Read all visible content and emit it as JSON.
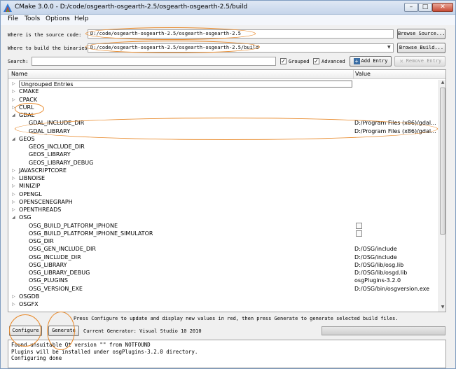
{
  "window": {
    "title": "CMake 3.0.0 - D:/code/osgearth-osgearth-2.5/osgearth-osgearth-2.5/build",
    "minimize": "–",
    "maximize": "□",
    "close": "✕"
  },
  "menu": [
    "File",
    "Tools",
    "Options",
    "Help"
  ],
  "source": {
    "label": "Where is the source code:",
    "value": "D:/code/osgearth-osgearth-2.5/osgearth-osgearth-2.5",
    "button": "Browse Source..."
  },
  "build": {
    "label": "Where to build the binaries:",
    "value": "D:/code/osgearth-osgearth-2.5/osgearth-osgearth-2.5/build",
    "dropdown": "▼",
    "button": "Browse Build..."
  },
  "search": {
    "label": "Search:",
    "value": "",
    "grouped_label": "Grouped",
    "grouped_checked": true,
    "advanced_label": "Advanced",
    "advanced_checked": true,
    "add_entry": "Add Entry",
    "remove_entry": "Remove Entry"
  },
  "table": {
    "col_name": "Name",
    "col_value": "Value",
    "rows": [
      {
        "name": "Ungrouped Entries",
        "level": 0,
        "arrow": "▷",
        "value": "",
        "edit": true
      },
      {
        "name": "CMAKE",
        "level": 0,
        "arrow": "▷",
        "value": ""
      },
      {
        "name": "CPACK",
        "level": 0,
        "arrow": "▷",
        "value": ""
      },
      {
        "name": "CURL",
        "level": 0,
        "arrow": "▷",
        "value": ""
      },
      {
        "name": "GDAL",
        "level": 0,
        "arrow": "◢",
        "value": ""
      },
      {
        "name": "GDAL_INCLUDE_DIR",
        "level": 1,
        "arrow": "",
        "value": "D:/Program Files (x86)/gdal..."
      },
      {
        "name": "GDAL_LIBRARY",
        "level": 1,
        "arrow": "",
        "value": "D:/Program Files (x86)/gdal..."
      },
      {
        "name": "GEOS",
        "level": 0,
        "arrow": "◢",
        "value": ""
      },
      {
        "name": "GEOS_INCLUDE_DIR",
        "level": 1,
        "arrow": "",
        "value": ""
      },
      {
        "name": "GEOS_LIBRARY",
        "level": 1,
        "arrow": "",
        "value": ""
      },
      {
        "name": "GEOS_LIBRARY_DEBUG",
        "level": 1,
        "arrow": "",
        "value": ""
      },
      {
        "name": "JAVASCRIPTCORE",
        "level": 0,
        "arrow": "▷",
        "value": ""
      },
      {
        "name": "LIBNOISE",
        "level": 0,
        "arrow": "▷",
        "value": ""
      },
      {
        "name": "MINIZIP",
        "level": 0,
        "arrow": "▷",
        "value": ""
      },
      {
        "name": "OPENGL",
        "level": 0,
        "arrow": "▷",
        "value": ""
      },
      {
        "name": "OPENSCENEGRAPH",
        "level": 0,
        "arrow": "▷",
        "value": ""
      },
      {
        "name": "OPENTHREADS",
        "level": 0,
        "arrow": "▷",
        "value": ""
      },
      {
        "name": "OSG",
        "level": 0,
        "arrow": "◢",
        "value": ""
      },
      {
        "name": "OSG_BUILD_PLATFORM_IPHONE",
        "level": 1,
        "arrow": "",
        "value": "",
        "checkbox": true
      },
      {
        "name": "OSG_BUILD_PLATFORM_IPHONE_SIMULATOR",
        "level": 1,
        "arrow": "",
        "value": "",
        "checkbox": true
      },
      {
        "name": "OSG_DIR",
        "level": 1,
        "arrow": "",
        "value": ""
      },
      {
        "name": "OSG_GEN_INCLUDE_DIR",
        "level": 1,
        "arrow": "",
        "value": "D:/OSG/include"
      },
      {
        "name": "OSG_INCLUDE_DIR",
        "level": 1,
        "arrow": "",
        "value": "D:/OSG/include"
      },
      {
        "name": "OSG_LIBRARY",
        "level": 1,
        "arrow": "",
        "value": "D:/OSG/lib/osg.lib"
      },
      {
        "name": "OSG_LIBRARY_DEBUG",
        "level": 1,
        "arrow": "",
        "value": "D:/OSG/lib/osgd.lib"
      },
      {
        "name": "OSG_PLUGINS",
        "level": 1,
        "arrow": "",
        "value": "osgPlugins-3.2.0"
      },
      {
        "name": "OSG_VERSION_EXE",
        "level": 1,
        "arrow": "",
        "value": "D:/OSG/bin/osgversion.exe"
      },
      {
        "name": "OSGDB",
        "level": 0,
        "arrow": "▷",
        "value": ""
      },
      {
        "name": "OSGFX",
        "level": 0,
        "arrow": "▷",
        "value": ""
      }
    ]
  },
  "hint": "Press Configure to update and display new values in red, then press Generate to generate selected build files.",
  "configure": "Configure",
  "generate": "Generate",
  "generator": "Current Generator: Visual Studio 10 2010",
  "output": [
    "Found unsuitable Qt version \"\" from NOTFOUND",
    "Plugins will be installed under osgPlugins-3.2.0 directory.",
    "Configuring done"
  ],
  "colors": {
    "annotation": "#e8892a",
    "accent": "#3b6ea5"
  }
}
